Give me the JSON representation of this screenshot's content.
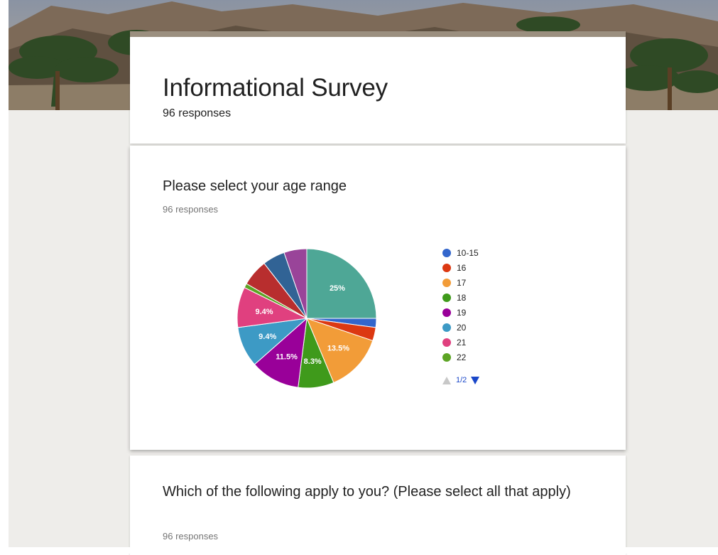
{
  "form": {
    "title": "Informational Survey",
    "responses": "96 responses"
  },
  "questions": [
    {
      "title": "Please select your age range",
      "responses": "96 responses"
    },
    {
      "title": "Which of the following apply to you? (Please select all that apply)",
      "responses": "96 responses"
    }
  ],
  "pager": {
    "label": "1/2"
  },
  "colors": {
    "header_accent": "#9b8f7f",
    "background": "#eeedea"
  },
  "chart_data": {
    "type": "pie",
    "title": "Please select your age range",
    "total_responses": 96,
    "legend_position": "right",
    "slices": [
      {
        "label": "",
        "value": 25.0,
        "color": "#4ea796",
        "text": "25%"
      },
      {
        "label": "10-15",
        "value": 2.1,
        "color": "#3366cc",
        "text": ""
      },
      {
        "label": "16",
        "value": 3.1,
        "color": "#dc3912",
        "text": ""
      },
      {
        "label": "17",
        "value": 13.5,
        "color": "#f29c38",
        "text": "13.5%"
      },
      {
        "label": "18",
        "value": 8.3,
        "color": "#3f9a1b",
        "text": "8.3%"
      },
      {
        "label": "19",
        "value": 11.5,
        "color": "#990099",
        "text": "11.5%"
      },
      {
        "label": "20",
        "value": 9.4,
        "color": "#3d9ac5",
        "text": "9.4%"
      },
      {
        "label": "21",
        "value": 9.4,
        "color": "#e0407f",
        "text": "9.4%"
      },
      {
        "label": "22",
        "value": 1.0,
        "color": "#5ca424",
        "text": ""
      },
      {
        "label": "",
        "value": 6.2,
        "color": "#b82e2e",
        "text": ""
      },
      {
        "label": "",
        "value": 5.2,
        "color": "#316395",
        "text": ""
      },
      {
        "label": "",
        "value": 5.3,
        "color": "#994499",
        "text": ""
      }
    ],
    "legend": [
      {
        "label": "10-15",
        "color": "#3366cc"
      },
      {
        "label": "16",
        "color": "#dc3912"
      },
      {
        "label": "17",
        "color": "#f29c38"
      },
      {
        "label": "18",
        "color": "#3f9a1b"
      },
      {
        "label": "19",
        "color": "#990099"
      },
      {
        "label": "20",
        "color": "#3d9ac5"
      },
      {
        "label": "21",
        "color": "#e0407f"
      },
      {
        "label": "22",
        "color": "#5ca424"
      }
    ]
  }
}
